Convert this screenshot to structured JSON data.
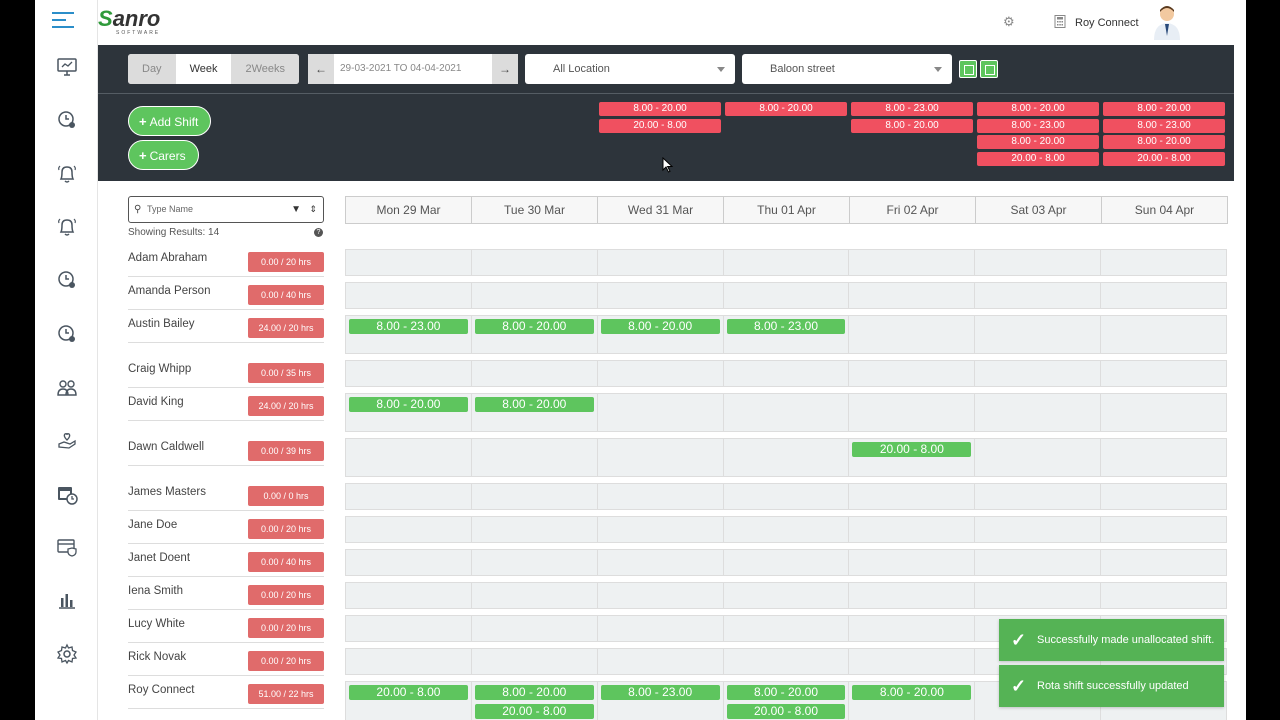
{
  "topbar": {
    "user_name": "Roy Connect",
    "logo_text": "anro",
    "logo_sub": "SOFTWARE"
  },
  "sidebar": {
    "items": [
      "dashboard",
      "clock-user",
      "bell",
      "bell-alt",
      "clock-user-2",
      "clock-user-3",
      "team",
      "hand-heart",
      "calendar-clock",
      "card-shield",
      "bar-chart",
      "settings"
    ]
  },
  "view_toggle": {
    "day": "Day",
    "week": "Week",
    "two_weeks": "2Weeks",
    "active": "Week"
  },
  "date_range": "29-03-2021 TO 04-04-2021",
  "location_select": "All Location",
  "street_select": "Baloon street",
  "buttons": {
    "add_shift": "Add Shift",
    "carers": "Carers"
  },
  "unallocated_shifts": [
    [],
    [],
    [
      "8.00 - 20.00",
      "20.00 - 8.00"
    ],
    [
      "8.00 - 20.00"
    ],
    [
      "8.00 - 23.00",
      "8.00 - 20.00"
    ],
    [
      "8.00 - 20.00",
      "8.00 - 23.00",
      "8.00 - 20.00",
      "20.00 - 8.00"
    ],
    [
      "8.00 - 20.00",
      "8.00 - 23.00",
      "8.00 - 20.00",
      "20.00 - 8.00"
    ]
  ],
  "search": {
    "placeholder": "Type Name"
  },
  "results_text": "Showing Results: 14",
  "days": [
    "Mon 29 Mar",
    "Tue 30 Mar",
    "Wed 31 Mar",
    "Thu 01 Apr",
    "Fri 02 Apr",
    "Sat 03 Apr",
    "Sun 04 Apr"
  ],
  "people": [
    {
      "name": "Adam Abraham",
      "hours": "0.00 / 20 hrs",
      "shifts": [
        [],
        [],
        [],
        [],
        [],
        [],
        []
      ]
    },
    {
      "name": "Amanda Person",
      "hours": "0.00 / 40 hrs",
      "shifts": [
        [],
        [],
        [],
        [],
        [],
        [],
        []
      ]
    },
    {
      "name": "Austin Bailey",
      "hours": "24.00 / 20 hrs",
      "shifts": [
        [
          "8.00 - 23.00"
        ],
        [
          "8.00 - 20.00"
        ],
        [
          "8.00 - 20.00"
        ],
        [
          "8.00 - 23.00"
        ],
        [],
        [],
        []
      ]
    },
    {
      "name": "Craig Whipp",
      "hours": "0.00 / 35 hrs",
      "shifts": [
        [],
        [],
        [],
        [],
        [],
        [],
        []
      ]
    },
    {
      "name": "David King",
      "hours": "24.00 / 20 hrs",
      "shifts": [
        [
          "8.00 - 20.00"
        ],
        [
          "8.00 - 20.00"
        ],
        [],
        [],
        [],
        [],
        []
      ]
    },
    {
      "name": "Dawn Caldwell",
      "hours": "0.00 / 39 hrs",
      "shifts": [
        [],
        [],
        [],
        [],
        [
          "20.00 - 8.00"
        ],
        [],
        []
      ]
    },
    {
      "name": "James Masters",
      "hours": "0.00 / 0 hrs",
      "shifts": [
        [],
        [],
        [],
        [],
        [],
        [],
        []
      ]
    },
    {
      "name": "Jane Doe",
      "hours": "0.00 / 20 hrs",
      "shifts": [
        [],
        [],
        [],
        [],
        [],
        [],
        []
      ]
    },
    {
      "name": "Janet Doent",
      "hours": "0.00 / 40 hrs",
      "shifts": [
        [],
        [],
        [],
        [],
        [],
        [],
        []
      ]
    },
    {
      "name": "Iena Smith",
      "hours": "0.00 / 20 hrs",
      "shifts": [
        [],
        [],
        [],
        [],
        [],
        [],
        []
      ]
    },
    {
      "name": "Lucy White",
      "hours": "0.00 / 20 hrs",
      "shifts": [
        [],
        [],
        [],
        [],
        [],
        [],
        []
      ]
    },
    {
      "name": "Rick Novak",
      "hours": "0.00 / 20 hrs",
      "shifts": [
        [],
        [],
        [],
        [],
        [],
        [],
        []
      ]
    },
    {
      "name": "Roy Connect",
      "hours": "51.00 / 22 hrs",
      "shifts": [
        [
          "20.00 - 8.00"
        ],
        [
          "8.00 - 20.00",
          "20.00 - 8.00"
        ],
        [
          "8.00 - 23.00"
        ],
        [
          "8.00 - 20.00",
          "20.00 - 8.00"
        ],
        [
          "8.00 - 20.00"
        ],
        [],
        []
      ]
    }
  ],
  "toasts": [
    "Successfully made unallocated shift.",
    "Rota shift successfully updated"
  ],
  "colors": {
    "accent_green": "#5ec55e",
    "alert_red": "#f05060",
    "hours_red": "#e06b6b",
    "dark_panel": "#2d343b"
  }
}
